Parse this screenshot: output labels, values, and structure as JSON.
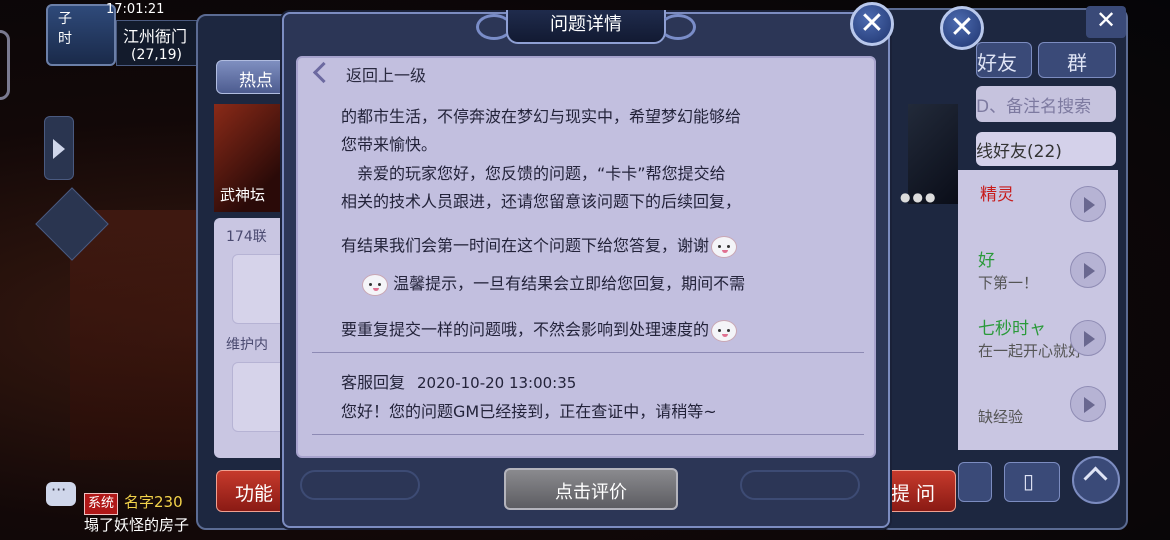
{
  "hud": {
    "time_label": "子 时",
    "clock": "17:01:21",
    "location_name": "江州衙门",
    "coords": "(27,19)"
  },
  "back_left": {
    "hot_tab": "热点",
    "banner_caption": "武神坛",
    "card_line1": "174联",
    "card_line2": "维护内",
    "function_button": "功能"
  },
  "chat": {
    "tag": "系统",
    "name": "名字230",
    "line1_rest": "",
    "line2": "塌了妖怪的房子"
  },
  "friends_panel": {
    "friends_tab": "好友",
    "group_tab": "群",
    "close": "✕",
    "search_placeholder": "D、备注名搜索",
    "online_header": "线好友(22)",
    "rows": [
      {
        "name": "精灵",
        "sub": "",
        "name_color": "#c81c1c"
      },
      {
        "name": "好",
        "sub": "下第一！",
        "name_color": "#2a9a3a"
      },
      {
        "name": "七秒时ャ",
        "sub": "在一起开心就好",
        "name_color": "#2a9a3a"
      },
      {
        "name": "",
        "sub": "缺经验",
        "name_color": "#333333"
      }
    ],
    "ask_button": "提 问",
    "tool_label": "⌖"
  },
  "dialog": {
    "title": "问题详情",
    "back_label": "返回上一级",
    "message_lines": [
      "的都市生活，不停奔波在梦幻与现实中，希望梦幻能够给",
      "您带来愉快。",
      "　亲爱的玩家您好，您反馈的问题，“卡卡”帮您提交给",
      "相关的技术人员跟进，还请您留意该问题下的后续回复，",
      "有结果我们会第一时间在这个问题下给您答复，谢谢",
      "温馨提示，一旦有结果会立即给您回复，期间不需",
      "要重复提交一样的问题哦，不然会影响到处理速度的"
    ],
    "reply_label": "客服回复",
    "reply_time": "2020-10-20 13:00:35",
    "reply_text": "您好！您的问题GM已经接到，正在查证中，请稍等~",
    "rate_button": "点击评价",
    "close": "✕"
  }
}
